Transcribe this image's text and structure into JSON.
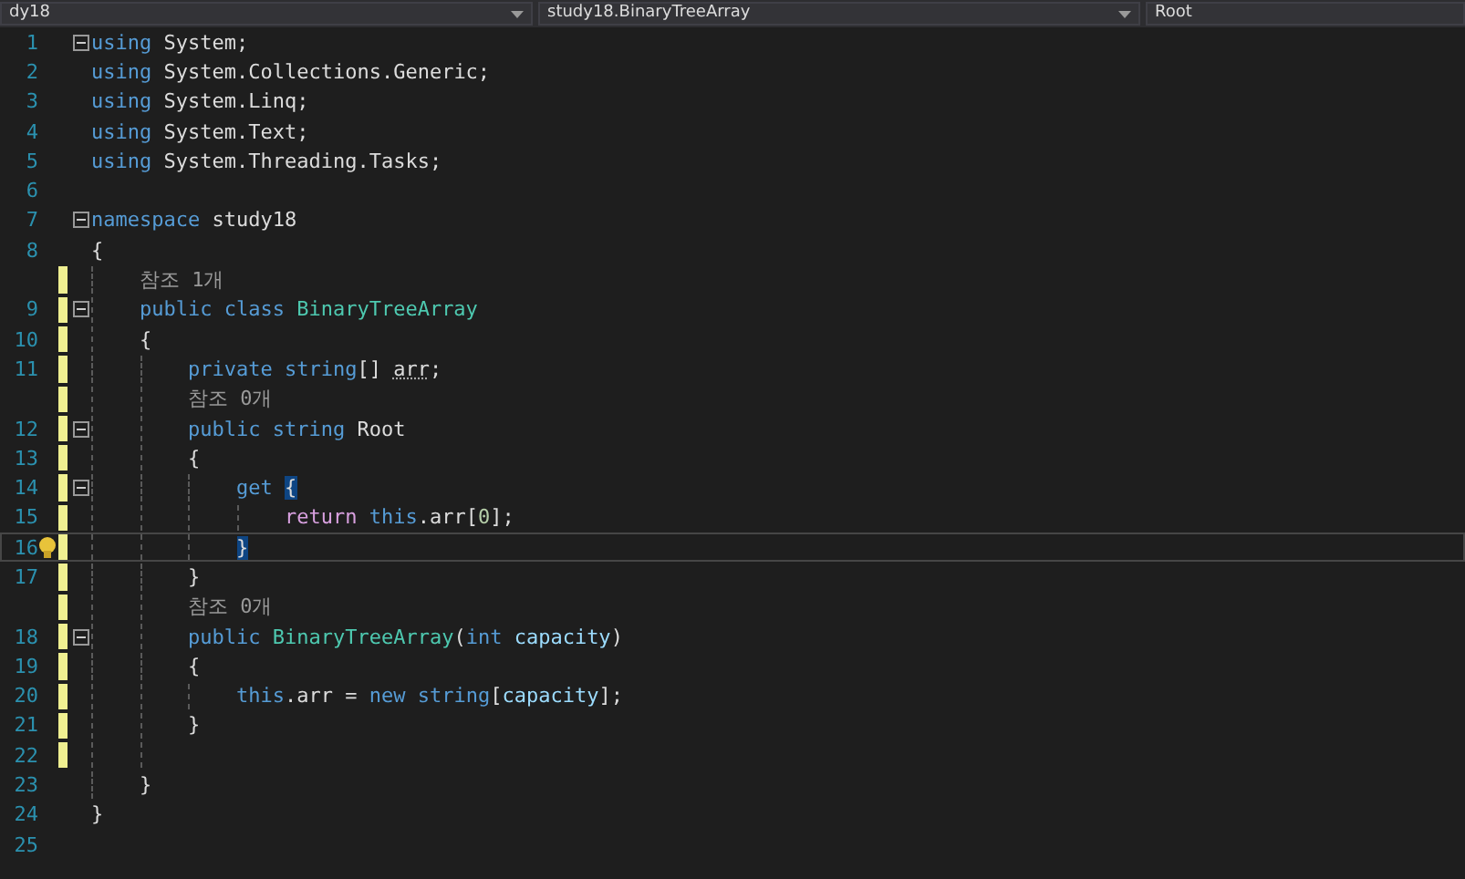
{
  "nav_bar": [
    {
      "text": "dy18"
    },
    {
      "text": "study18.BinaryTreeArray"
    },
    {
      "text": "Root"
    }
  ],
  "rows": [
    {
      "kind": "code",
      "number": "1",
      "fold": true,
      "changed": false,
      "current": false,
      "guides": [],
      "tokens": [
        {
          "kind": "kw",
          "t": "using"
        },
        {
          "kind": "pl",
          "t": " System;"
        }
      ]
    },
    {
      "kind": "code",
      "number": "2",
      "fold": false,
      "changed": false,
      "current": false,
      "guides": [],
      "tokens": [
        {
          "kind": "kw",
          "t": "using"
        },
        {
          "kind": "pl",
          "t": " System.Collections.Generic;"
        }
      ]
    },
    {
      "kind": "code",
      "number": "3",
      "fold": false,
      "changed": false,
      "current": false,
      "guides": [],
      "tokens": [
        {
          "kind": "kw",
          "t": "using"
        },
        {
          "kind": "pl",
          "t": " System.Linq;"
        }
      ]
    },
    {
      "kind": "code",
      "number": "4",
      "fold": false,
      "changed": false,
      "current": false,
      "guides": [],
      "tokens": [
        {
          "kind": "kw",
          "t": "using"
        },
        {
          "kind": "pl",
          "t": " System.Text;"
        }
      ]
    },
    {
      "kind": "code",
      "number": "5",
      "fold": false,
      "changed": false,
      "current": false,
      "guides": [],
      "tokens": [
        {
          "kind": "kw",
          "t": "using"
        },
        {
          "kind": "pl",
          "t": " System.Threading.Tasks;"
        }
      ]
    },
    {
      "kind": "code",
      "number": "6",
      "fold": false,
      "changed": false,
      "current": false,
      "guides": [],
      "tokens": []
    },
    {
      "kind": "code",
      "number": "7",
      "fold": true,
      "changed": false,
      "current": false,
      "guides": [],
      "tokens": [
        {
          "kind": "kw",
          "t": "namespace"
        },
        {
          "kind": "pl",
          "t": " study18"
        }
      ]
    },
    {
      "kind": "code",
      "number": "8",
      "fold": false,
      "changed": false,
      "current": false,
      "guides": [],
      "tokens": [
        {
          "kind": "pl",
          "t": "{"
        }
      ]
    },
    {
      "kind": "lens",
      "changed": true,
      "guides": [
        {
          "kind": "dashed"
        }
      ],
      "text": "참조 1개"
    },
    {
      "kind": "code",
      "number": "9",
      "fold": true,
      "changed": true,
      "current": false,
      "guides": [
        {
          "kind": "dashed"
        }
      ],
      "tokens": [
        {
          "kind": "kw",
          "t": "public class "
        },
        {
          "kind": "ty",
          "t": "BinaryTreeArray"
        }
      ]
    },
    {
      "kind": "code",
      "number": "10",
      "fold": false,
      "changed": true,
      "current": false,
      "guides": [
        {
          "kind": "dashed"
        }
      ],
      "tokens": [
        {
          "kind": "pl",
          "t": "{"
        }
      ]
    },
    {
      "kind": "code",
      "number": "11",
      "fold": false,
      "changed": true,
      "current": false,
      "guides": [
        {
          "kind": "dashed"
        },
        {
          "kind": "dashed"
        }
      ],
      "tokens": [
        {
          "kind": "kw",
          "t": "private string"
        },
        {
          "kind": "pl",
          "t": "[] "
        },
        {
          "kind": "hint",
          "t": "arr"
        },
        {
          "kind": "pl",
          "t": ";"
        }
      ]
    },
    {
      "kind": "lens",
      "changed": true,
      "guides": [
        {
          "kind": "dashed"
        },
        {
          "kind": "dashed"
        }
      ],
      "text": "참조 0개"
    },
    {
      "kind": "code",
      "number": "12",
      "fold": true,
      "changed": true,
      "current": false,
      "guides": [
        {
          "kind": "dashed"
        },
        {
          "kind": "dashed"
        }
      ],
      "tokens": [
        {
          "kind": "kw",
          "t": "public string "
        },
        {
          "kind": "pl",
          "t": "Root"
        }
      ]
    },
    {
      "kind": "code",
      "number": "13",
      "fold": false,
      "changed": true,
      "current": false,
      "guides": [
        {
          "kind": "dashed"
        },
        {
          "kind": "dashed"
        }
      ],
      "tokens": [
        {
          "kind": "pl",
          "t": "{"
        }
      ]
    },
    {
      "kind": "code",
      "number": "14",
      "fold": true,
      "changed": true,
      "current": false,
      "guides": [
        {
          "kind": "dashed"
        },
        {
          "kind": "dashed"
        },
        {
          "kind": "dashed"
        }
      ],
      "tokens": [
        {
          "kind": "kw",
          "t": "get "
        },
        {
          "kind": "match",
          "t": "{"
        }
      ]
    },
    {
      "kind": "code",
      "number": "15",
      "fold": false,
      "changed": true,
      "current": false,
      "guides": [
        {
          "kind": "dashed"
        },
        {
          "kind": "dashed"
        },
        {
          "kind": "dashed"
        },
        {
          "kind": "dashed"
        }
      ],
      "tokens": [
        {
          "kind": "ctl",
          "t": "return "
        },
        {
          "kind": "kw",
          "t": "this"
        },
        {
          "kind": "pl",
          "t": ".arr["
        },
        {
          "kind": "num",
          "t": "0"
        },
        {
          "kind": "pl",
          "t": "];"
        }
      ]
    },
    {
      "kind": "code",
      "number": "16",
      "fold": false,
      "changed": true,
      "current": true,
      "guides": [
        {
          "kind": "dashed"
        },
        {
          "kind": "dashed"
        },
        {
          "kind": "dashed"
        }
      ],
      "tokens": [
        {
          "kind": "match",
          "t": "}"
        }
      ]
    },
    {
      "kind": "code",
      "number": "17",
      "fold": false,
      "changed": true,
      "current": false,
      "guides": [
        {
          "kind": "dashed"
        },
        {
          "kind": "dashed"
        }
      ],
      "tokens": [
        {
          "kind": "pl",
          "t": "}"
        }
      ]
    },
    {
      "kind": "lens",
      "changed": true,
      "guides": [
        {
          "kind": "dashed"
        },
        {
          "kind": "dashed"
        }
      ],
      "text": "참조 0개"
    },
    {
      "kind": "code",
      "number": "18",
      "fold": true,
      "changed": true,
      "current": false,
      "guides": [
        {
          "kind": "dashed"
        },
        {
          "kind": "dashed"
        }
      ],
      "tokens": [
        {
          "kind": "kw",
          "t": "public "
        },
        {
          "kind": "ty",
          "t": "BinaryTreeArray"
        },
        {
          "kind": "pl",
          "t": "("
        },
        {
          "kind": "kw",
          "t": "int "
        },
        {
          "kind": "par",
          "t": "capacity"
        },
        {
          "kind": "pl",
          "t": ")"
        }
      ]
    },
    {
      "kind": "code",
      "number": "19",
      "fold": false,
      "changed": true,
      "current": false,
      "guides": [
        {
          "kind": "dashed"
        },
        {
          "kind": "dashed"
        }
      ],
      "tokens": [
        {
          "kind": "pl",
          "t": "{"
        }
      ]
    },
    {
      "kind": "code",
      "number": "20",
      "fold": false,
      "changed": true,
      "current": false,
      "guides": [
        {
          "kind": "dashed"
        },
        {
          "kind": "dashed"
        },
        {
          "kind": "dashed"
        }
      ],
      "tokens": [
        {
          "kind": "kw",
          "t": "this"
        },
        {
          "kind": "pl",
          "t": ".arr = "
        },
        {
          "kind": "kw",
          "t": "new string"
        },
        {
          "kind": "pl",
          "t": "["
        },
        {
          "kind": "par",
          "t": "capacity"
        },
        {
          "kind": "pl",
          "t": "];"
        }
      ]
    },
    {
      "kind": "code",
      "number": "21",
      "fold": false,
      "changed": true,
      "current": false,
      "guides": [
        {
          "kind": "dashed"
        },
        {
          "kind": "dashed"
        }
      ],
      "tokens": [
        {
          "kind": "pl",
          "t": "}"
        }
      ]
    },
    {
      "kind": "code",
      "number": "22",
      "fold": false,
      "changed": true,
      "current": false,
      "guides": [
        {
          "kind": "dashed"
        },
        {
          "kind": "dashed"
        }
      ],
      "tokens": []
    },
    {
      "kind": "code",
      "number": "23",
      "fold": false,
      "changed": false,
      "current": false,
      "guides": [
        {
          "kind": "dashed"
        }
      ],
      "tokens": [
        {
          "kind": "pl",
          "t": "}"
        }
      ]
    },
    {
      "kind": "code",
      "number": "24",
      "fold": false,
      "changed": false,
      "current": false,
      "guides": [],
      "tokens": [
        {
          "kind": "pl",
          "t": "}"
        }
      ]
    },
    {
      "kind": "code",
      "number": "25",
      "fold": false,
      "changed": false,
      "current": false,
      "guides": [],
      "tokens": []
    }
  ]
}
